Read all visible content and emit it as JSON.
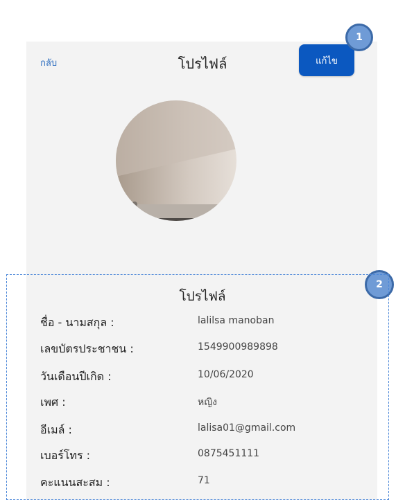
{
  "header": {
    "back_label": "กลับ",
    "title": "โปรไฟล์",
    "edit_label": "แก้ไข"
  },
  "annotations": {
    "badge_1": "1",
    "badge_2": "2"
  },
  "profile": {
    "section_title": "โปรไฟล์",
    "fields": [
      {
        "label": "ชื่อ - นามสกุล :",
        "value": "lalilsa manoban"
      },
      {
        "label": "เลขบัตรประชาชน :",
        "value": "1549900989898"
      },
      {
        "label": "วันเดือนปีเกิด :",
        "value": "10/06/2020"
      },
      {
        "label": "เพศ :",
        "value": "หญิง"
      },
      {
        "label": "อีเมล์ :",
        "value": "lalisa01@gmail.com"
      },
      {
        "label": "เบอร์โทร :",
        "value": "0875451111"
      },
      {
        "label": "คะแนนสะสม :",
        "value": "71"
      }
    ]
  },
  "colors": {
    "accent": "#0b58c0",
    "badge": "#6f9bd6",
    "dashed_border": "#4a86d8"
  }
}
